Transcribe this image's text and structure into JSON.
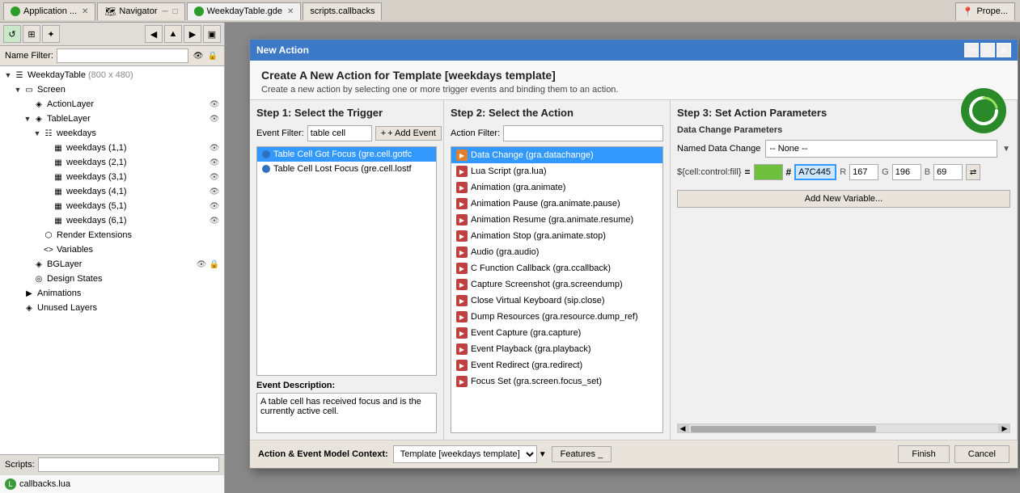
{
  "app": {
    "title": "Application ...",
    "tabs": [
      {
        "id": "app",
        "label": "Application ...",
        "active": false,
        "icon": "app-icon"
      },
      {
        "id": "navigator",
        "label": "Navigator",
        "active": false,
        "icon": "nav-icon"
      },
      {
        "id": "weekday",
        "label": "WeekdayTable.gde",
        "active": true,
        "icon": "gde-icon"
      },
      {
        "id": "scripts",
        "label": "scripts.callbacks",
        "active": false,
        "icon": "script-icon"
      },
      {
        "id": "properties",
        "label": "Prope...",
        "active": false,
        "icon": "prop-icon"
      }
    ]
  },
  "left_panel": {
    "name_filter_label": "Name Filter:",
    "name_filter_value": "",
    "tree": [
      {
        "id": "weekdaytable",
        "label": "WeekdayTable (800 x 480)",
        "level": 0,
        "type": "table",
        "expandable": true,
        "expanded": true,
        "has_eye": false,
        "has_lock": false
      },
      {
        "id": "screen",
        "label": "Screen",
        "level": 1,
        "type": "screen",
        "expandable": true,
        "expanded": true,
        "has_eye": false,
        "has_lock": false
      },
      {
        "id": "actionlayer",
        "label": "ActionLayer",
        "level": 2,
        "type": "layer",
        "expandable": false,
        "expanded": false,
        "has_eye": true,
        "has_lock": false
      },
      {
        "id": "tablelayer",
        "label": "TableLayer",
        "level": 2,
        "type": "layer",
        "expandable": true,
        "expanded": true,
        "has_eye": true,
        "has_lock": false
      },
      {
        "id": "weekdays",
        "label": "weekdays",
        "level": 3,
        "type": "table",
        "expandable": true,
        "expanded": true,
        "has_eye": false,
        "has_lock": false
      },
      {
        "id": "weekdays11",
        "label": "weekdays (1,1)",
        "level": 4,
        "type": "cell",
        "expandable": false,
        "expanded": false,
        "has_eye": true,
        "has_lock": false
      },
      {
        "id": "weekdays21",
        "label": "weekdays (2,1)",
        "level": 4,
        "type": "cell",
        "expandable": false,
        "expanded": false,
        "has_eye": true,
        "has_lock": false
      },
      {
        "id": "weekdays31",
        "label": "weekdays (3,1)",
        "level": 4,
        "type": "cell",
        "expandable": false,
        "expanded": false,
        "has_eye": true,
        "has_lock": false
      },
      {
        "id": "weekdays41",
        "label": "weekdays (4,1)",
        "level": 4,
        "type": "cell",
        "expandable": false,
        "expanded": false,
        "has_eye": true,
        "has_lock": false
      },
      {
        "id": "weekdays51",
        "label": "weekdays (5,1)",
        "level": 4,
        "type": "cell",
        "expandable": false,
        "expanded": false,
        "has_eye": true,
        "has_lock": false
      },
      {
        "id": "weekdays61",
        "label": "weekdays (6,1)",
        "level": 4,
        "type": "cell",
        "expandable": false,
        "expanded": false,
        "has_eye": true,
        "has_lock": false
      },
      {
        "id": "renderext",
        "label": "Render Extensions",
        "level": 3,
        "type": "render",
        "expandable": false,
        "expanded": false,
        "has_eye": false,
        "has_lock": false
      },
      {
        "id": "variables",
        "label": "Variables",
        "level": 3,
        "type": "vars",
        "expandable": false,
        "expanded": false,
        "has_eye": false,
        "has_lock": false
      },
      {
        "id": "bglayer",
        "label": "BGLayer",
        "level": 2,
        "type": "layer",
        "expandable": false,
        "expanded": false,
        "has_eye": true,
        "has_lock": true
      },
      {
        "id": "designstates",
        "label": "Design States",
        "level": 2,
        "type": "states",
        "expandable": false,
        "expanded": false,
        "has_eye": false,
        "has_lock": false
      },
      {
        "id": "animations",
        "label": "Animations",
        "level": 1,
        "type": "anim",
        "expandable": false,
        "expanded": false,
        "has_eye": false,
        "has_lock": false
      },
      {
        "id": "unusedlayers",
        "label": "Unused Layers",
        "level": 1,
        "type": "unused",
        "expandable": false,
        "expanded": false,
        "has_eye": false,
        "has_lock": false
      }
    ],
    "scripts_label": "Scripts:",
    "scripts_value": "",
    "callbacks_item": "callbacks.lua"
  },
  "modal": {
    "title": "New Action",
    "header_title": "Create A New Action for Template [weekdays template]",
    "header_sub": "Create a new action by selecting one or more trigger events and binding them to an action.",
    "step1": {
      "title": "Step 1: Select the Trigger",
      "event_filter_label": "Event Filter:",
      "event_filter_value": "table cell",
      "add_event_label": "+ Add Event",
      "events": [
        {
          "label": "Table Cell Got Focus (gre.cell.gotfc",
          "selected": true
        },
        {
          "label": "Table Cell Lost Focus (gre.cell.lostf",
          "selected": false
        }
      ],
      "event_desc_label": "Event Description:",
      "event_desc_text": "A table cell has received focus and is the currently active cell."
    },
    "step2": {
      "title": "Step 2: Select the Action",
      "action_filter_label": "Action Filter:",
      "action_filter_value": "",
      "actions": [
        {
          "label": "Data Change (gra.datachange)",
          "selected": true
        },
        {
          "label": "Lua Script (gra.lua)",
          "selected": false
        },
        {
          "label": "Animation (gra.animate)",
          "selected": false
        },
        {
          "label": "Animation Pause (gra.animate.pause)",
          "selected": false
        },
        {
          "label": "Animation Resume (gra.animate.resume)",
          "selected": false
        },
        {
          "label": "Animation Stop (gra.animate.stop)",
          "selected": false
        },
        {
          "label": "Audio (gra.audio)",
          "selected": false
        },
        {
          "label": "C Function Callback (gra.ccallback)",
          "selected": false
        },
        {
          "label": "Capture Screenshot (gra.screendump)",
          "selected": false
        },
        {
          "label": "Close Virtual Keyboard (sip.close)",
          "selected": false
        },
        {
          "label": "Dump Resources (gra.resource.dump_ref)",
          "selected": false
        },
        {
          "label": "Event Capture (gra.capture)",
          "selected": false
        },
        {
          "label": "Event Playback (gra.playback)",
          "selected": false
        },
        {
          "label": "Event Redirect (gra.redirect)",
          "selected": false
        },
        {
          "label": "Focus Set (gra.screen.focus_set)",
          "selected": false
        }
      ]
    },
    "step3": {
      "title": "Step 3: Set Action Parameters",
      "data_change_params_label": "Data Change Parameters",
      "named_data_change_label": "Named Data Change",
      "named_data_change_value": "-- None --",
      "formula_prefix": "${cell:control:fill}",
      "formula_eq": "=",
      "color_hex": "A7C445",
      "r_label": "R",
      "r_value": "167",
      "g_label": "G",
      "g_value": "196",
      "b_label": "B",
      "b_value": "69",
      "add_variable_label": "Add New Variable..."
    },
    "footer": {
      "context_label": "Action & Event Model Context:",
      "context_value": "Template [weekdays template]",
      "features_label": "Features _",
      "finish_label": "Finish",
      "cancel_label": "Cancel"
    }
  }
}
